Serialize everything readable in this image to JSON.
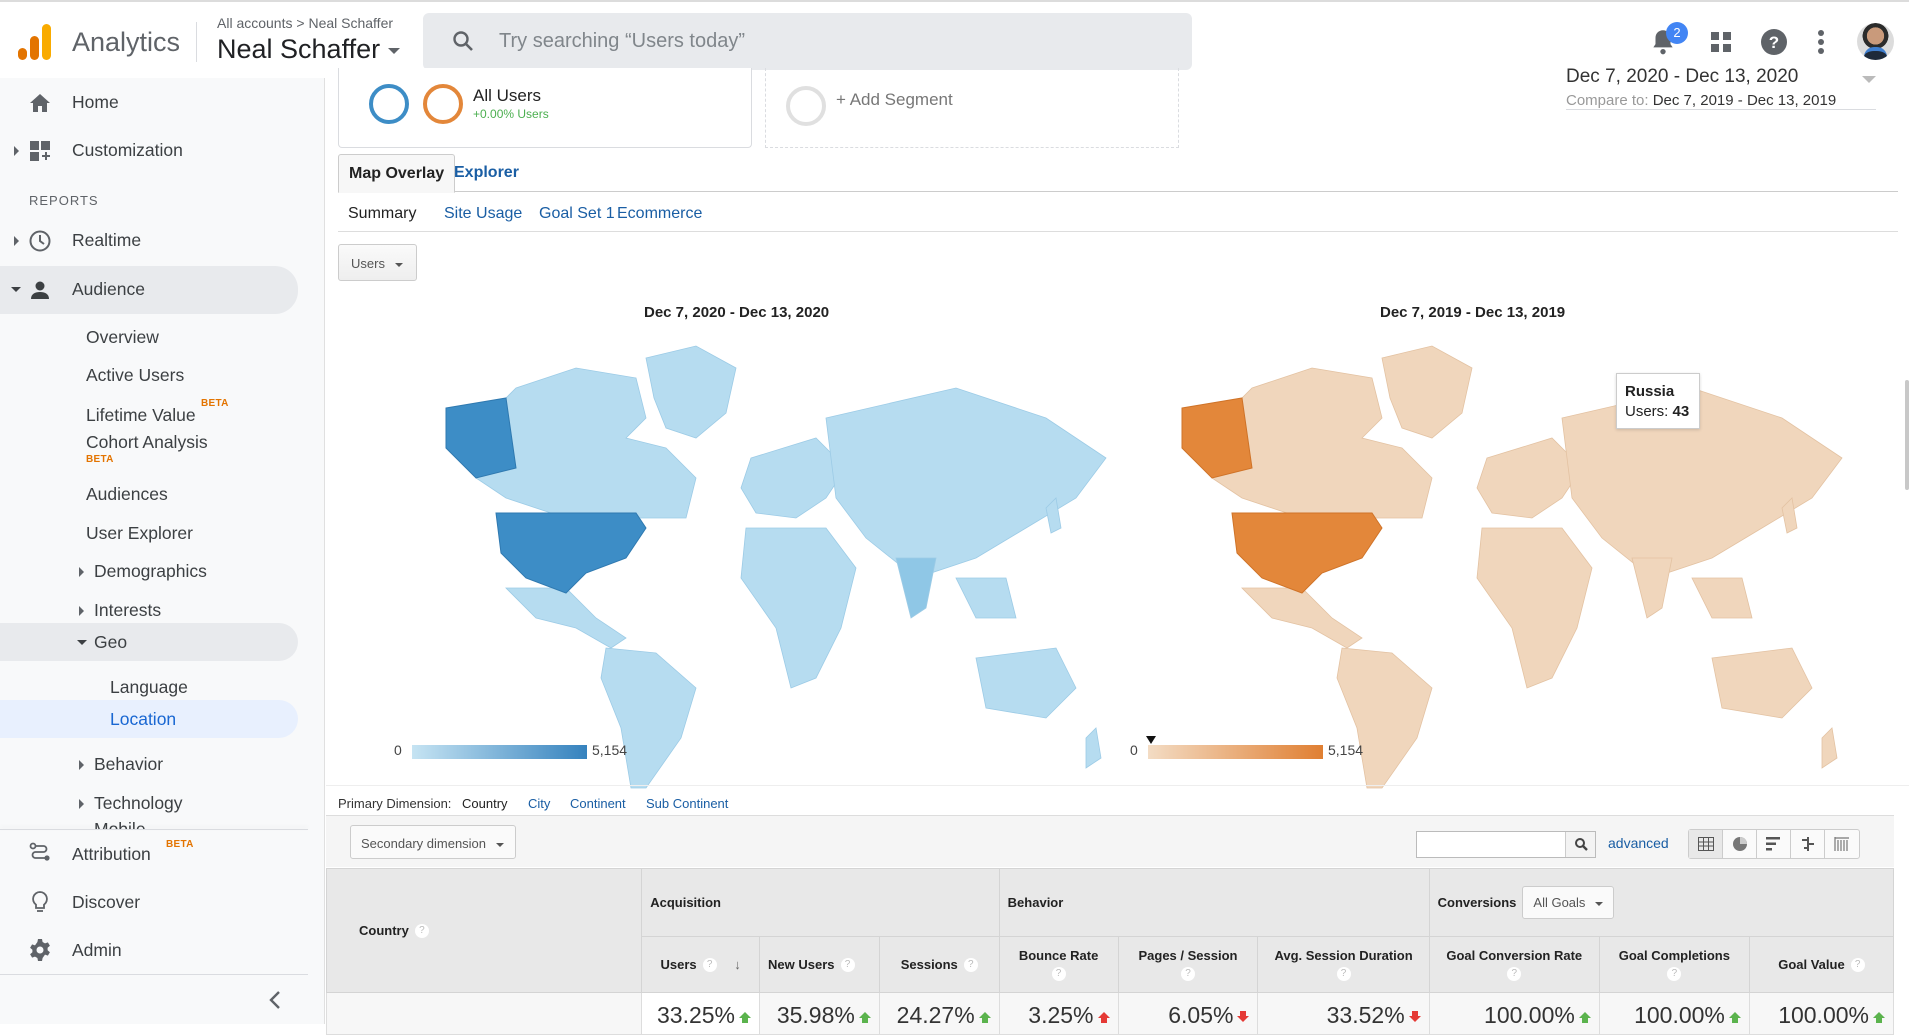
{
  "header": {
    "app_name": "Analytics",
    "breadcrumb": [
      "All accounts",
      "Neal Schaffer"
    ],
    "breadcrumb_separator": ">",
    "account_name": "Neal Schaffer",
    "search_placeholder": "Try searching “Users today”",
    "notification_count": "2",
    "icons": [
      "bell-icon",
      "apps-grid-icon",
      "help-icon",
      "more-vert-icon",
      "avatar"
    ]
  },
  "sidebar": {
    "top_items": [
      {
        "label": "Home",
        "icon": "home-icon"
      },
      {
        "label": "Customization",
        "icon": "dashboard-icon"
      }
    ],
    "section_label": "REPORTS",
    "realtime": "Realtime",
    "audience": "Audience",
    "audience_children": [
      {
        "label": "Overview"
      },
      {
        "label": "Active Users"
      },
      {
        "label": "Lifetime Value",
        "badge": "BETA"
      },
      {
        "label": "Cohort Analysis",
        "badge": "BETA"
      },
      {
        "label": "Audiences"
      },
      {
        "label": "User Explorer"
      },
      {
        "label": "Demographics"
      },
      {
        "label": "Interests"
      },
      {
        "label": "Geo"
      },
      {
        "label": "Language"
      },
      {
        "label": "Location"
      },
      {
        "label": "Behavior"
      },
      {
        "label": "Technology"
      },
      {
        "label": "Mobile"
      }
    ],
    "bottom_items": [
      {
        "label": "Attribution",
        "badge": "BETA",
        "icon": "attribution-icon"
      },
      {
        "label": "Discover",
        "icon": "lightbulb-icon"
      },
      {
        "label": "Admin",
        "icon": "gear-icon"
      }
    ],
    "collapse_label": "<"
  },
  "segments": {
    "segment_name": "All Users",
    "segment_change": "+0.00% Users",
    "add_segment": "+ Add Segment",
    "colors": {
      "current": "#3d8dc6",
      "previous": "#e3873a"
    }
  },
  "date_range": {
    "current": "Dec 7, 2020 - Dec 13, 2020",
    "compare_label": "Compare to:",
    "compare": "Dec 7, 2019 - Dec 13, 2019"
  },
  "tabs": [
    "Map Overlay",
    "Explorer"
  ],
  "subtabs": [
    "Summary",
    "Site Usage",
    "Goal Set 1",
    "Ecommerce"
  ],
  "metric_selector": "Users",
  "maps": [
    {
      "title": "Dec 7, 2020 - Dec 13, 2020",
      "legend_min": "0",
      "legend_max": "5,154",
      "color_low": "#c6e4f3",
      "color_high": "#3582be"
    },
    {
      "title": "Dec 7, 2019 - Dec 13, 2019",
      "legend_min": "0",
      "legend_max": "5,154",
      "color_low": "#f3dcc4",
      "color_high": "#e07f32"
    }
  ],
  "tooltip": {
    "country": "Russia",
    "metric_label": "Users:",
    "value": "43"
  },
  "primary_dimension": {
    "label": "Primary Dimension:",
    "options": [
      "Country",
      "City",
      "Continent",
      "Sub Continent"
    ],
    "active": "Country"
  },
  "table_toolbar": {
    "secondary_dimension": "Secondary dimension",
    "search_value": "",
    "advanced": "advanced",
    "view_icons": [
      "table-view-icon",
      "pie-view-icon",
      "performance-view-icon",
      "comparison-view-icon",
      "pivot-view-icon"
    ]
  },
  "table": {
    "dimension_header": "Country",
    "groups": [
      {
        "label": "Acquisition"
      },
      {
        "label": "Behavior"
      },
      {
        "label": "Conversions",
        "selector": "All Goals"
      }
    ],
    "columns": [
      {
        "label": "Users",
        "sorted": true
      },
      {
        "label": "New Users"
      },
      {
        "label": "Sessions"
      },
      {
        "label": "Bounce Rate"
      },
      {
        "label": "Pages / Session"
      },
      {
        "label": "Avg. Session Duration"
      },
      {
        "label": "Goal Conversion Rate"
      },
      {
        "label": "Goal Completions"
      },
      {
        "label": "Goal Value"
      }
    ],
    "summary_row": [
      {
        "value": "33.25%",
        "trend": "up",
        "color": "green"
      },
      {
        "value": "35.98%",
        "trend": "up",
        "color": "green"
      },
      {
        "value": "24.27%",
        "trend": "up",
        "color": "green"
      },
      {
        "value": "3.25%",
        "trend": "up",
        "color": "red"
      },
      {
        "value": "6.05%",
        "trend": "down",
        "color": "red"
      },
      {
        "value": "33.52%",
        "trend": "down",
        "color": "red"
      },
      {
        "value": "100.00%",
        "trend": "up",
        "color": "green"
      },
      {
        "value": "100.00%",
        "trend": "up",
        "color": "green"
      },
      {
        "value": "100.00%",
        "trend": "up",
        "color": "green"
      }
    ]
  }
}
